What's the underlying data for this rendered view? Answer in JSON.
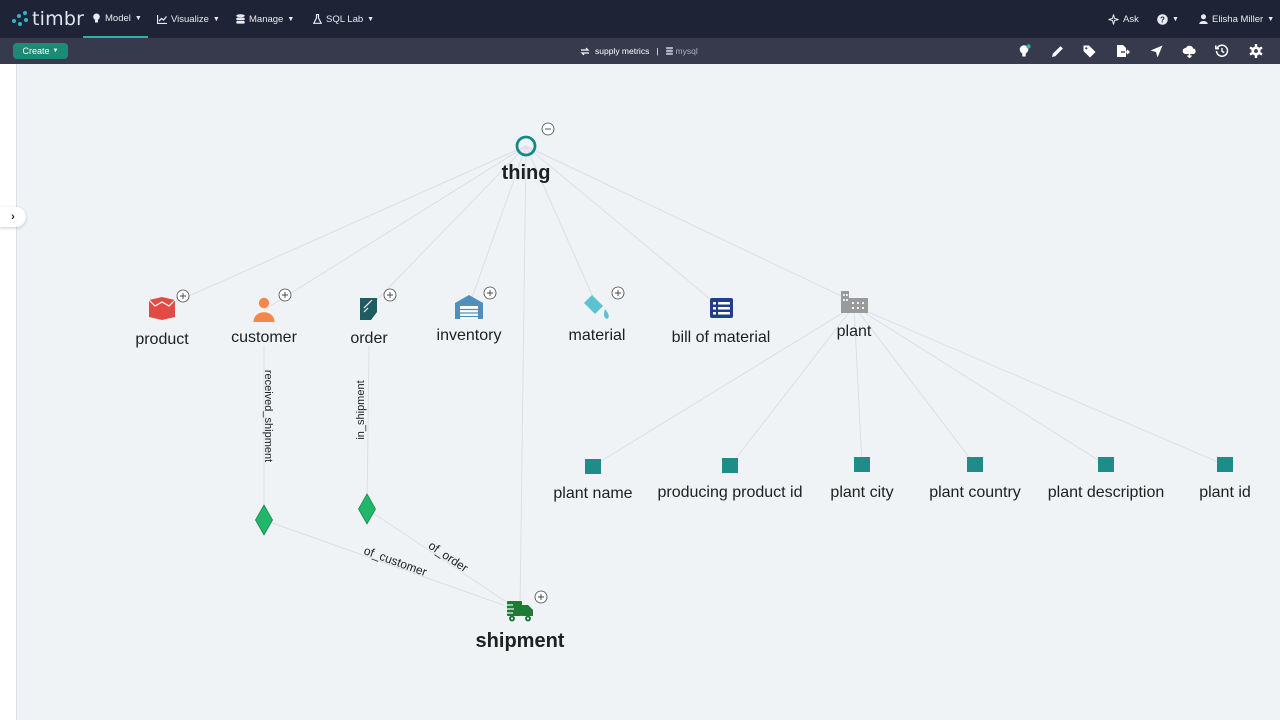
{
  "app": {
    "logo_text": "timbr"
  },
  "nav": {
    "items": [
      {
        "label": "Model",
        "icon": "bulb-icon",
        "active": true
      },
      {
        "label": "Visualize",
        "icon": "chart-icon"
      },
      {
        "label": "Manage",
        "icon": "database-icon"
      },
      {
        "label": "SQL Lab",
        "icon": "flask-icon"
      }
    ],
    "ask_label": "Ask",
    "user_name": "Elisha Miller"
  },
  "toolbar": {
    "create_label": "Create",
    "ontology_name": "supply metrics",
    "separator": "|",
    "datasource_name": "mysql",
    "tools": [
      "lightbulb-icon",
      "pencil-icon",
      "tags-icon",
      "export-icon",
      "navigate-icon",
      "cloud-icon",
      "history-icon",
      "settings-icon"
    ]
  },
  "graph": {
    "root": {
      "label": "thing"
    },
    "concepts": [
      {
        "id": "product",
        "label": "product",
        "icon": "box-icon",
        "color": "#e24a44"
      },
      {
        "id": "customer",
        "label": "customer",
        "icon": "person-icon",
        "color": "#f4874a"
      },
      {
        "id": "order",
        "label": "order",
        "icon": "order-icon",
        "color": "#1e5c63"
      },
      {
        "id": "inventory",
        "label": "inventory",
        "icon": "warehouse-icon",
        "color": "#4f8fbd"
      },
      {
        "id": "material",
        "label": "material",
        "icon": "paint-bucket-icon",
        "color": "#5bc3cf"
      },
      {
        "id": "bom",
        "label": "bill of material",
        "icon": "list-icon",
        "color": "#1f3f8e"
      },
      {
        "id": "plant",
        "label": "plant",
        "icon": "building-icon",
        "color": "#9a9a9a"
      },
      {
        "id": "shipment",
        "label": "shipment",
        "icon": "truck-icon",
        "color": "#1e7a35"
      }
    ],
    "properties": [
      {
        "label": "plant name"
      },
      {
        "label": "producing product id"
      },
      {
        "label": "plant city"
      },
      {
        "label": "plant country"
      },
      {
        "label": "plant description"
      },
      {
        "label": "plant id"
      }
    ],
    "relations": [
      {
        "label": "received_shipment"
      },
      {
        "label": "in_shipment"
      },
      {
        "label": "of_customer"
      },
      {
        "label": "of_order"
      }
    ],
    "colors": {
      "property": "#1f8c8a",
      "relation_node": "#21b76a",
      "edge": "#dcdfe3",
      "root_ring": "#138a87"
    }
  }
}
